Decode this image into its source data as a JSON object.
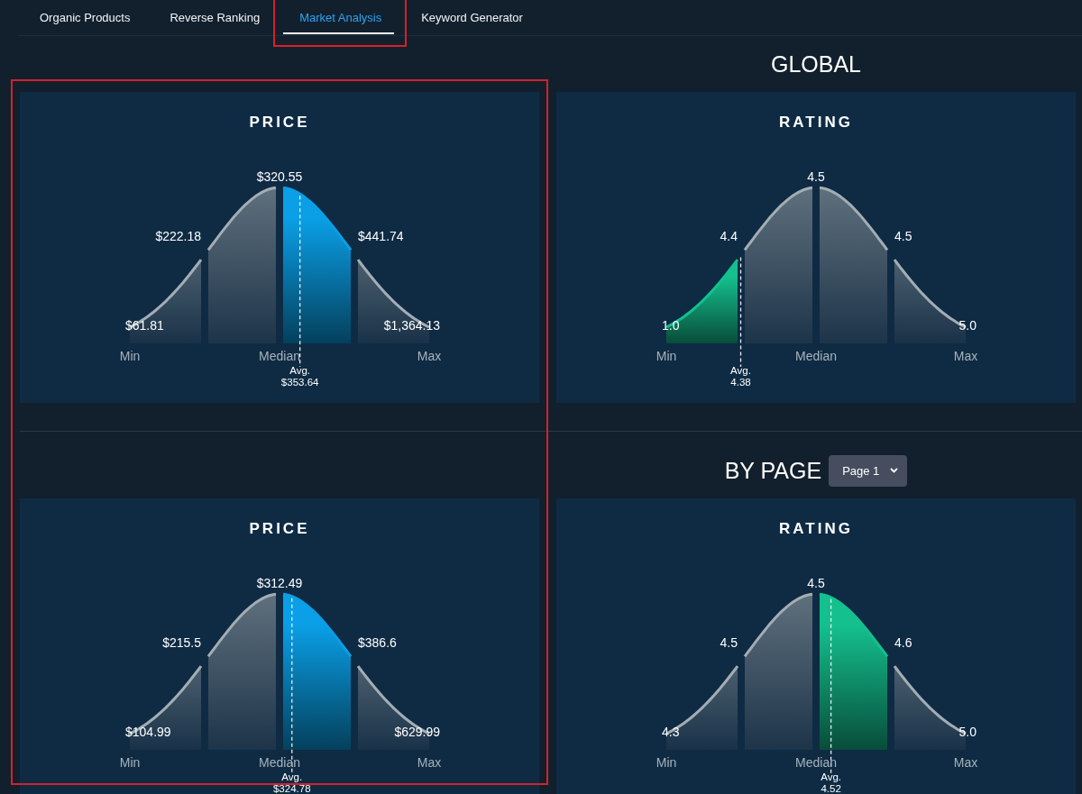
{
  "tabs": [
    {
      "label": "Organic Products",
      "selected": false
    },
    {
      "label": "Reverse Ranking",
      "selected": false
    },
    {
      "label": "Market Analysis",
      "selected": true
    },
    {
      "label": "Keyword Generator",
      "selected": false
    }
  ],
  "sections": [
    {
      "title": "GLOBAL",
      "charts": [
        {
          "title": "PRICE",
          "points": [
            "$61.81",
            "$222.18",
            "$320.55",
            "$441.74",
            "$1,364.13"
          ],
          "axis_labels": [
            "Min",
            "Median",
            "Max"
          ],
          "avg_label": "Avg.",
          "avg_value": "$353.64",
          "color": "#0a9fe6"
        },
        {
          "title": "RATING",
          "points": [
            "1.0",
            "4.4",
            "4.5",
            "4.5",
            "5.0"
          ],
          "axis_labels": [
            "Min",
            "Median",
            "Max"
          ],
          "avg_label": "Avg.",
          "avg_value": "4.38",
          "color": "#14c08e"
        }
      ]
    },
    {
      "title": "BY PAGE",
      "page_select": {
        "value": "Page 1"
      },
      "charts": [
        {
          "title": "PRICE",
          "points": [
            "$104.99",
            "$215.5",
            "$312.49",
            "$386.6",
            "$629.99"
          ],
          "axis_labels": [
            "Min",
            "Median",
            "Max"
          ],
          "avg_label": "Avg.",
          "avg_value": "$324.78",
          "color": "#0a9fe6"
        },
        {
          "title": "RATING",
          "points": [
            "4.3",
            "4.5",
            "4.5",
            "4.6",
            "5.0"
          ],
          "axis_labels": [
            "Min",
            "Median",
            "Max"
          ],
          "avg_label": "Avg.",
          "avg_value": "4.52",
          "color": "#14c08e"
        }
      ]
    }
  ]
}
